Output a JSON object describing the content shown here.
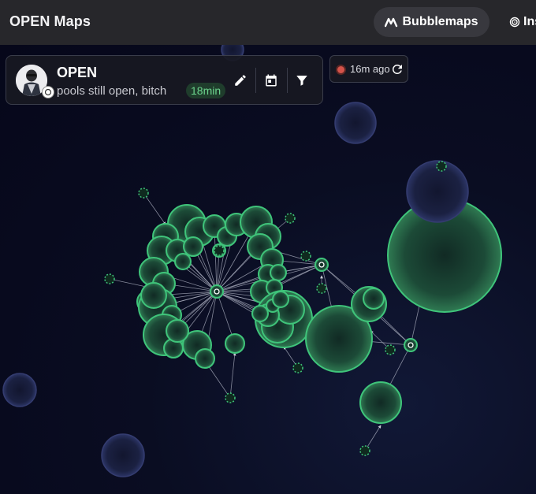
{
  "app": {
    "title": "OPEN Maps"
  },
  "nav": {
    "active_label": "Bubblemaps",
    "next_label": "Ins"
  },
  "token": {
    "name": "OPEN",
    "description": "pools still open, bitch",
    "age": "18min"
  },
  "refresh": {
    "updated": "16m ago"
  },
  "colors": {
    "bubble_green": "#3fc47a",
    "bubble_dark": "#1e2246",
    "background": "#07081a",
    "badge_green": "#6cd48d",
    "live_red": "#d4534a"
  },
  "icons": {
    "nav_active": "bubblemaps-logo-icon",
    "nav_next": "fingerprint-icon",
    "edit": "pencil-icon",
    "calendar": "calendar-icon",
    "filter": "filter-icon",
    "refresh": "refresh-icon"
  }
}
